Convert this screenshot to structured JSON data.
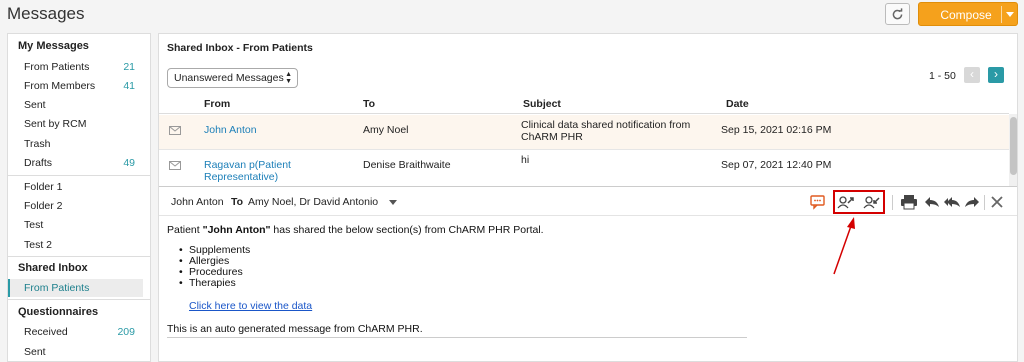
{
  "app": {
    "title": "Messages",
    "compose_label": "Compose"
  },
  "sidebar": {
    "sections": [
      {
        "heading": "My Messages",
        "items": [
          {
            "label": "From Patients",
            "count": "21"
          },
          {
            "label": "From Members",
            "count": "41"
          },
          {
            "label": "Sent",
            "count": ""
          },
          {
            "label": "Sent by RCM",
            "count": ""
          },
          {
            "label": "Trash",
            "count": ""
          },
          {
            "label": "Drafts",
            "count": "49"
          }
        ]
      },
      {
        "heading": "",
        "items": [
          {
            "label": "Folder 1"
          },
          {
            "label": "Folder 2"
          },
          {
            "label": "Test"
          },
          {
            "label": "Test 2"
          }
        ]
      },
      {
        "heading": "Shared Inbox",
        "items": [
          {
            "label": "From Patients",
            "active": true
          }
        ]
      },
      {
        "heading": "Questionnaires",
        "items": [
          {
            "label": "Received",
            "count": "209"
          },
          {
            "label": "Sent",
            "count": ""
          }
        ]
      }
    ]
  },
  "inbox": {
    "title": "Shared Inbox - From Patients",
    "filter": "Unanswered Messages",
    "pager": "1 - 50",
    "columns": {
      "from": "From",
      "to": "To",
      "subject": "Subject",
      "date": "Date"
    },
    "rows": [
      {
        "from": "John Anton",
        "to": "Amy Noel",
        "subject": "Clinical data shared notification from ChARM PHR",
        "date": "Sep 15, 2021 02:16 PM",
        "highlighted": true
      },
      {
        "from": "Ragavan p(Patient Representative)",
        "to": "Denise Braithwaite",
        "subject": "hi",
        "date": "Sep 07, 2021 12:40 PM",
        "highlighted": false
      }
    ]
  },
  "viewer": {
    "from": "John Anton",
    "to_label": "To",
    "to": "Amy Noel, Dr David Antonio",
    "icons": [
      "comment-icon",
      "assign-user-icon",
      "reassign-user-icon",
      "print-icon",
      "reply-icon",
      "reply-all-icon",
      "forward-icon",
      "close-icon"
    ]
  },
  "message": {
    "intro_prefix": "Patient ",
    "patient": "\"John Anton\"",
    "intro_suffix": " has shared the below section(s) from ChARM PHR Portal.",
    "sections": [
      "Supplements",
      "Allergies",
      "Procedures",
      "Therapies"
    ],
    "link": "Click here to view the data",
    "footer": "This is an auto generated message from ChARM PHR."
  },
  "colors": {
    "accent": "#2a9aa6",
    "compose": "#f5a11c",
    "highlight": "#d40000",
    "link": "#1c7fb8"
  }
}
